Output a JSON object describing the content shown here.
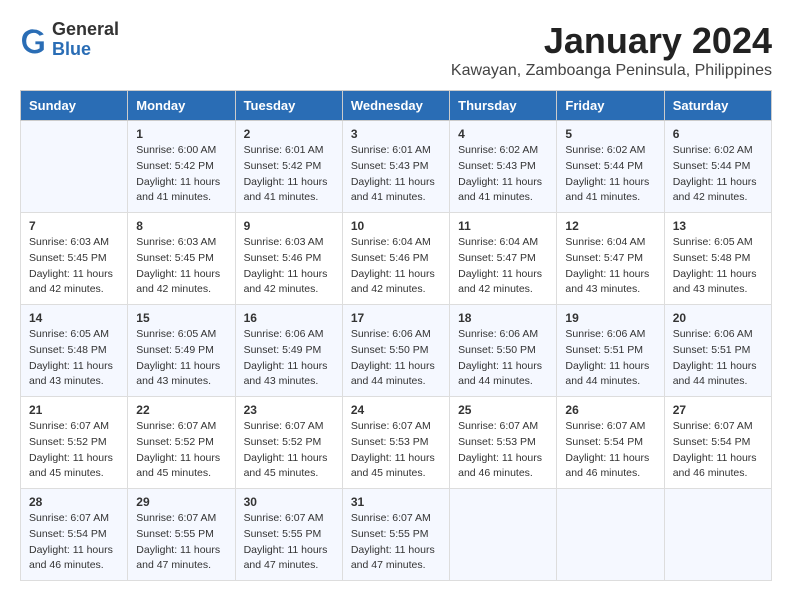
{
  "header": {
    "logo_general": "General",
    "logo_blue": "Blue",
    "month_title": "January 2024",
    "location": "Kawayan, Zamboanga Peninsula, Philippines"
  },
  "days_of_week": [
    "Sunday",
    "Monday",
    "Tuesday",
    "Wednesday",
    "Thursday",
    "Friday",
    "Saturday"
  ],
  "weeks": [
    [
      {
        "day": "",
        "info": ""
      },
      {
        "day": "1",
        "info": "Sunrise: 6:00 AM\nSunset: 5:42 PM\nDaylight: 11 hours\nand 41 minutes."
      },
      {
        "day": "2",
        "info": "Sunrise: 6:01 AM\nSunset: 5:42 PM\nDaylight: 11 hours\nand 41 minutes."
      },
      {
        "day": "3",
        "info": "Sunrise: 6:01 AM\nSunset: 5:43 PM\nDaylight: 11 hours\nand 41 minutes."
      },
      {
        "day": "4",
        "info": "Sunrise: 6:02 AM\nSunset: 5:43 PM\nDaylight: 11 hours\nand 41 minutes."
      },
      {
        "day": "5",
        "info": "Sunrise: 6:02 AM\nSunset: 5:44 PM\nDaylight: 11 hours\nand 41 minutes."
      },
      {
        "day": "6",
        "info": "Sunrise: 6:02 AM\nSunset: 5:44 PM\nDaylight: 11 hours\nand 42 minutes."
      }
    ],
    [
      {
        "day": "7",
        "info": "Sunrise: 6:03 AM\nSunset: 5:45 PM\nDaylight: 11 hours\nand 42 minutes."
      },
      {
        "day": "8",
        "info": "Sunrise: 6:03 AM\nSunset: 5:45 PM\nDaylight: 11 hours\nand 42 minutes."
      },
      {
        "day": "9",
        "info": "Sunrise: 6:03 AM\nSunset: 5:46 PM\nDaylight: 11 hours\nand 42 minutes."
      },
      {
        "day": "10",
        "info": "Sunrise: 6:04 AM\nSunset: 5:46 PM\nDaylight: 11 hours\nand 42 minutes."
      },
      {
        "day": "11",
        "info": "Sunrise: 6:04 AM\nSunset: 5:47 PM\nDaylight: 11 hours\nand 42 minutes."
      },
      {
        "day": "12",
        "info": "Sunrise: 6:04 AM\nSunset: 5:47 PM\nDaylight: 11 hours\nand 43 minutes."
      },
      {
        "day": "13",
        "info": "Sunrise: 6:05 AM\nSunset: 5:48 PM\nDaylight: 11 hours\nand 43 minutes."
      }
    ],
    [
      {
        "day": "14",
        "info": "Sunrise: 6:05 AM\nSunset: 5:48 PM\nDaylight: 11 hours\nand 43 minutes."
      },
      {
        "day": "15",
        "info": "Sunrise: 6:05 AM\nSunset: 5:49 PM\nDaylight: 11 hours\nand 43 minutes."
      },
      {
        "day": "16",
        "info": "Sunrise: 6:06 AM\nSunset: 5:49 PM\nDaylight: 11 hours\nand 43 minutes."
      },
      {
        "day": "17",
        "info": "Sunrise: 6:06 AM\nSunset: 5:50 PM\nDaylight: 11 hours\nand 44 minutes."
      },
      {
        "day": "18",
        "info": "Sunrise: 6:06 AM\nSunset: 5:50 PM\nDaylight: 11 hours\nand 44 minutes."
      },
      {
        "day": "19",
        "info": "Sunrise: 6:06 AM\nSunset: 5:51 PM\nDaylight: 11 hours\nand 44 minutes."
      },
      {
        "day": "20",
        "info": "Sunrise: 6:06 AM\nSunset: 5:51 PM\nDaylight: 11 hours\nand 44 minutes."
      }
    ],
    [
      {
        "day": "21",
        "info": "Sunrise: 6:07 AM\nSunset: 5:52 PM\nDaylight: 11 hours\nand 45 minutes."
      },
      {
        "day": "22",
        "info": "Sunrise: 6:07 AM\nSunset: 5:52 PM\nDaylight: 11 hours\nand 45 minutes."
      },
      {
        "day": "23",
        "info": "Sunrise: 6:07 AM\nSunset: 5:52 PM\nDaylight: 11 hours\nand 45 minutes."
      },
      {
        "day": "24",
        "info": "Sunrise: 6:07 AM\nSunset: 5:53 PM\nDaylight: 11 hours\nand 45 minutes."
      },
      {
        "day": "25",
        "info": "Sunrise: 6:07 AM\nSunset: 5:53 PM\nDaylight: 11 hours\nand 46 minutes."
      },
      {
        "day": "26",
        "info": "Sunrise: 6:07 AM\nSunset: 5:54 PM\nDaylight: 11 hours\nand 46 minutes."
      },
      {
        "day": "27",
        "info": "Sunrise: 6:07 AM\nSunset: 5:54 PM\nDaylight: 11 hours\nand 46 minutes."
      }
    ],
    [
      {
        "day": "28",
        "info": "Sunrise: 6:07 AM\nSunset: 5:54 PM\nDaylight: 11 hours\nand 46 minutes."
      },
      {
        "day": "29",
        "info": "Sunrise: 6:07 AM\nSunset: 5:55 PM\nDaylight: 11 hours\nand 47 minutes."
      },
      {
        "day": "30",
        "info": "Sunrise: 6:07 AM\nSunset: 5:55 PM\nDaylight: 11 hours\nand 47 minutes."
      },
      {
        "day": "31",
        "info": "Sunrise: 6:07 AM\nSunset: 5:55 PM\nDaylight: 11 hours\nand 47 minutes."
      },
      {
        "day": "",
        "info": ""
      },
      {
        "day": "",
        "info": ""
      },
      {
        "day": "",
        "info": ""
      }
    ]
  ]
}
